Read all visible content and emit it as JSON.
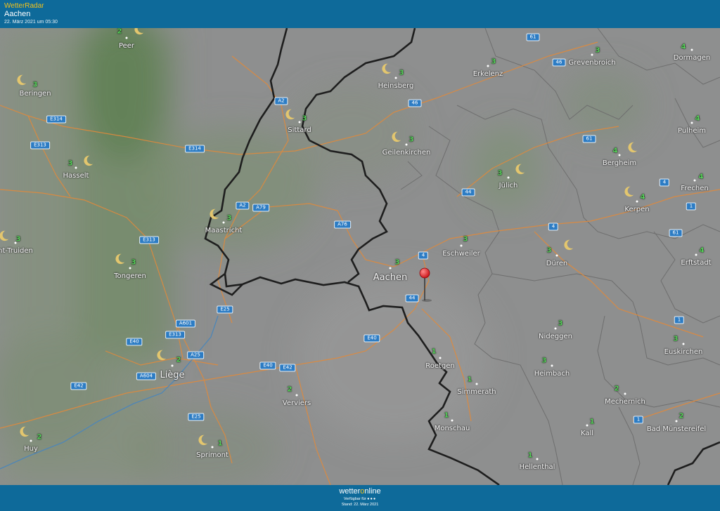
{
  "header": {
    "app_name": "WetterRadar",
    "location": "Aachen",
    "timestamp": "22. März 2021 um 05:30"
  },
  "footer": {
    "brand_prefix": "wetter",
    "brand_o": "o",
    "brand_suffix": "nline",
    "available_text": "Verfügbar für",
    "stand_text": "Stand: 22. März 2021"
  },
  "colors": {
    "bar": "#0e6a9a",
    "accent": "#f2c21b",
    "value": "#57d35a",
    "road_sign": "#2c7cc4",
    "road_line": "#e08a3c",
    "border": "#222222",
    "pin": "#e0151b"
  },
  "icons": {
    "moon": "crescent-moon-icon",
    "pin": "map-pin-icon"
  },
  "places": [
    {
      "name": "Peer",
      "value": "2",
      "moon": true
    },
    {
      "name": "Beringen",
      "value": "3",
      "moon": true
    },
    {
      "name": "Hasselt",
      "value": "3",
      "moon": true
    },
    {
      "name": "nt-Truiden",
      "value": "3",
      "moon": true
    },
    {
      "name": "Tongeren",
      "value": "3",
      "moon": true
    },
    {
      "name": "Maastricht",
      "value": "3",
      "moon": true
    },
    {
      "name": "Sittard",
      "value": "3",
      "moon": true
    },
    {
      "name": "Heinsberg",
      "value": "3",
      "moon": true
    },
    {
      "name": "Erkelenz",
      "value": "3",
      "moon": false
    },
    {
      "name": "Geilenkirchen",
      "value": "3",
      "moon": true
    },
    {
      "name": "Grevenbroich",
      "value": "3",
      "moon": false
    },
    {
      "name": "Dormagen",
      "value": "4",
      "moon": false
    },
    {
      "name": "Pulheim",
      "value": "4",
      "moon": false
    },
    {
      "name": "Bergheim",
      "value": "4",
      "moon": true
    },
    {
      "name": "Jülich",
      "value": "3",
      "moon": true
    },
    {
      "name": "Kerpen",
      "value": "4",
      "moon": true
    },
    {
      "name": "Frechen",
      "value": "4",
      "moon": false
    },
    {
      "name": "Erftstadt",
      "value": "4",
      "moon": false
    },
    {
      "name": "Eschweiler",
      "value": "3",
      "moon": false
    },
    {
      "name": "Aachen",
      "value": "3",
      "moon": false
    },
    {
      "name": "Düren",
      "value": "3",
      "moon": true
    },
    {
      "name": "Nideggen",
      "value": "3",
      "moon": false
    },
    {
      "name": "Euskirchen",
      "value": "3",
      "moon": false
    },
    {
      "name": "Heimbach",
      "value": "3",
      "moon": false
    },
    {
      "name": "Roetgen",
      "value": "1",
      "moon": false
    },
    {
      "name": "Simmerath",
      "value": "1",
      "moon": false
    },
    {
      "name": "Mechernich",
      "value": "2",
      "moon": false
    },
    {
      "name": "Monschau",
      "value": "1",
      "moon": false
    },
    {
      "name": "Kall",
      "value": "1",
      "moon": false
    },
    {
      "name": "Bad Münstereifel",
      "value": "2",
      "moon": false
    },
    {
      "name": "Hellenthal",
      "value": "1",
      "moon": false
    },
    {
      "name": "Liège",
      "value": "2",
      "moon": true
    },
    {
      "name": "Verviers",
      "value": "2",
      "moon": false
    },
    {
      "name": "Huy",
      "value": "2",
      "moon": true
    },
    {
      "name": "Sprimont",
      "value": "1",
      "moon": true
    }
  ],
  "roads": [
    "E314",
    "E313",
    "E314",
    "A2",
    "A2",
    "A79",
    "A76",
    "46",
    "61",
    "46",
    "61",
    "44",
    "4",
    "4",
    "1",
    "61",
    "4",
    "44",
    "E313",
    "E25",
    "A601",
    "E313",
    "E40",
    "A25",
    "A604",
    "E42",
    "E40",
    "E42",
    "E40",
    "E25",
    "1",
    "1"
  ]
}
